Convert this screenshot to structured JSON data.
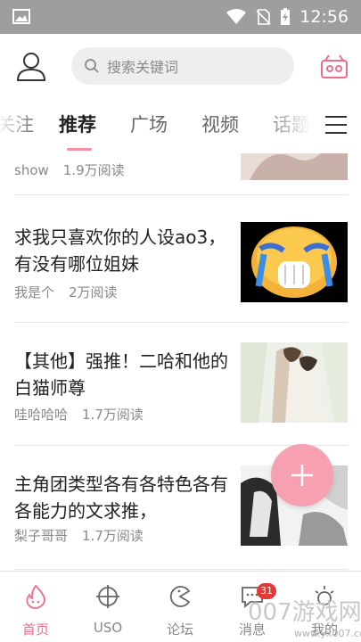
{
  "status_bar": {
    "time": "12:56"
  },
  "header": {
    "search_placeholder": "搜索关键词"
  },
  "tabs": [
    {
      "label": "关注"
    },
    {
      "label": "推荐"
    },
    {
      "label": "广场"
    },
    {
      "label": "视频"
    },
    {
      "label": "话题"
    }
  ],
  "feed": [
    {
      "title": "",
      "author": "show",
      "reads": "1.9万阅读"
    },
    {
      "title": "求我只喜欢你的人设ao3，有没有哪位姐妹",
      "author": "我是个",
      "reads": "2万阅读"
    },
    {
      "title": "【其他】强推！二哈和他的白猫师尊",
      "author": "哇哈哈哈",
      "reads": "1.7万阅读"
    },
    {
      "title": "主角团类型各有各特色各有各能力的文求推，",
      "author": "梨子哥哥",
      "reads": "1.7万阅读"
    }
  ],
  "bottom_nav": [
    {
      "label": "首页",
      "icon": "flame-face-icon"
    },
    {
      "label": "USO",
      "icon": "crosshair-icon"
    },
    {
      "label": "论坛",
      "icon": "pacman-icon"
    },
    {
      "label": "消息",
      "icon": "message-icon"
    },
    {
      "label": "我的",
      "icon": "sun-icon"
    }
  ],
  "message_badge": "31",
  "watermark": {
    "big": "007游戏网",
    "small": "www.yx007.com"
  },
  "colors": {
    "accent": "#f06b8a",
    "fab": "#f6a0b1",
    "status_bar": "#9e9e9e",
    "badge": "#e53935"
  }
}
